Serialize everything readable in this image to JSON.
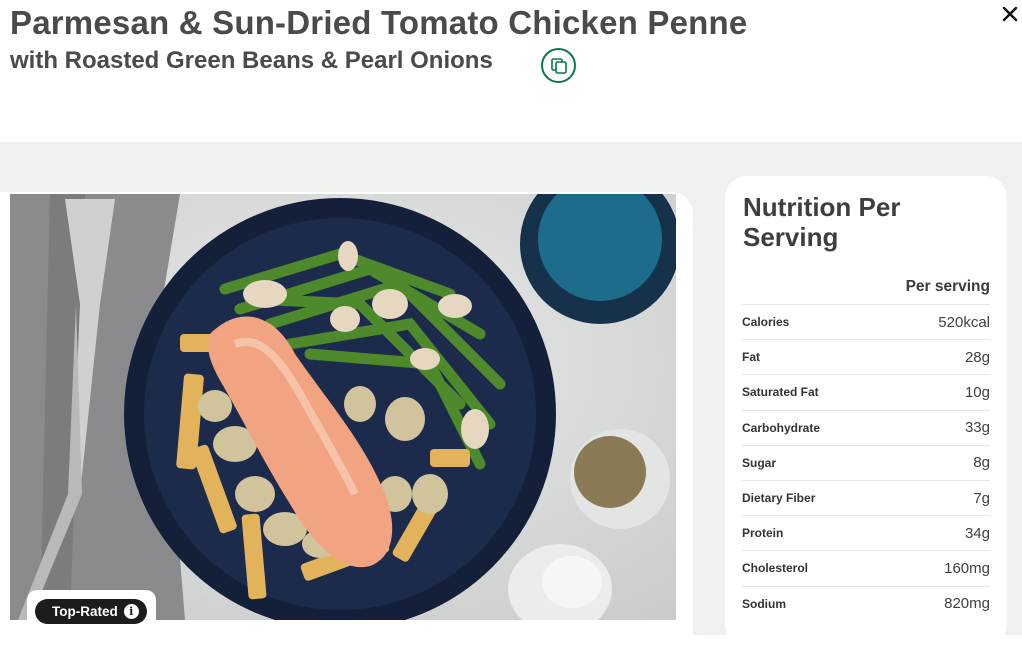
{
  "recipe": {
    "title": "Parmesan & Sun-Dried Tomato Chicken Penne",
    "subtitle": "with Roasted Green Beans & Pearl Onions"
  },
  "badge": {
    "label": "Top-Rated",
    "info_glyph": "i"
  },
  "nutrition": {
    "title": "Nutrition Per Serving",
    "column_header": "Per serving",
    "rows": [
      {
        "label": "Calories",
        "value": "520kcal"
      },
      {
        "label": "Fat",
        "value": "28g"
      },
      {
        "label": "Saturated Fat",
        "value": "10g"
      },
      {
        "label": "Carbohydrate",
        "value": "33g"
      },
      {
        "label": "Sugar",
        "value": "8g"
      },
      {
        "label": "Dietary Fiber",
        "value": "7g"
      },
      {
        "label": "Protein",
        "value": "34g"
      },
      {
        "label": "Cholesterol",
        "value": "160mg"
      },
      {
        "label": "Sodium",
        "value": "820mg"
      }
    ]
  },
  "icons": {
    "copy": "copy-icon",
    "close": "close-icon",
    "info": "info-icon"
  },
  "colors": {
    "accent": "#067a46",
    "background": "#eff1ef",
    "text": "#4a4a4a"
  }
}
